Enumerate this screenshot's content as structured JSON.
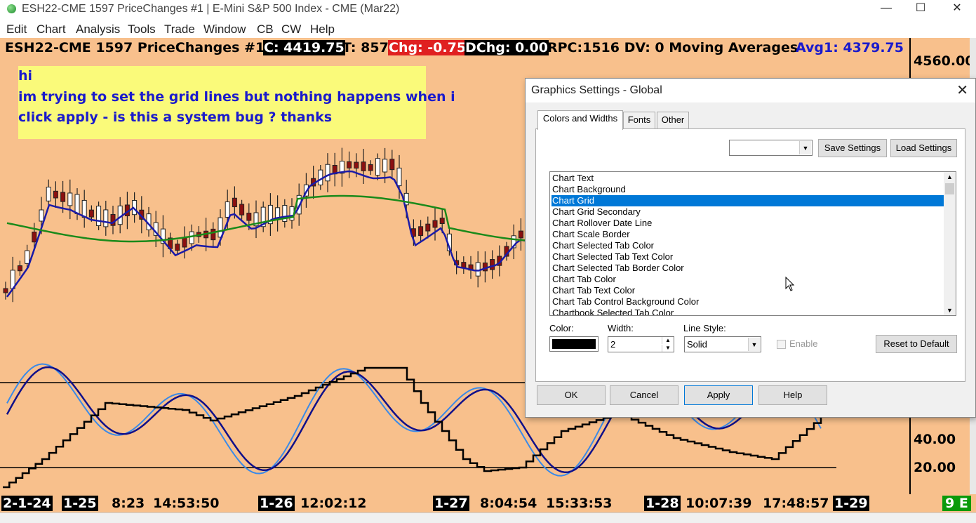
{
  "window": {
    "title": "ESH22-CME  1597 PriceChanges  #1 | E-Mini S&P 500 Index - CME (Mar22)",
    "minimize": "—",
    "maximize": "☐",
    "close": "✕"
  },
  "menu": [
    "Edit",
    "Chart",
    "Analysis",
    "Tools",
    "Trade",
    "Window",
    "CB",
    "CW",
    "Help"
  ],
  "info_bar": {
    "symbol": "ESH22-CME  1597 PriceChanges  #1",
    "close": "C: 4419.75",
    "ticks": "T: 857",
    "chg": "Chg: -0.75",
    "dchg": "DChg: 0.00",
    "study": "RPC:1516 DV: 0 Moving Averages",
    "avg1": "Avg1: 4379.75",
    "colors": {
      "close_bg": "#000000",
      "chg_bg": "#e02020",
      "avg1": "#1a1acc"
    }
  },
  "note": {
    "line1": "hi",
    "line2": "im trying to set the grid lines but nothing happens when i",
    "line3": "click apply - is this a system bug ? thanks"
  },
  "price_axis": {
    "top_label": "4560.00",
    "osc_labels": [
      "40.00",
      "20.00"
    ],
    "corner_badge": "9 E"
  },
  "time_axis": {
    "labels": [
      {
        "text": "2-1-24",
        "boxed": true
      },
      {
        "text": "1-25",
        "boxed": true
      },
      {
        "text": "8:23",
        "boxed": false
      },
      {
        "text": "14:53:50",
        "boxed": false
      },
      {
        "text": "1-26",
        "boxed": true
      },
      {
        "text": "12:02:12",
        "boxed": false
      },
      {
        "text": "1-27",
        "boxed": true
      },
      {
        "text": "8:04:54",
        "boxed": false
      },
      {
        "text": "15:33:53",
        "boxed": false
      },
      {
        "text": "1-28",
        "boxed": true
      },
      {
        "text": "10:07:39",
        "boxed": false
      },
      {
        "text": "17:48:57",
        "boxed": false
      },
      {
        "text": "1-29",
        "boxed": true
      }
    ]
  },
  "dialog": {
    "title": "Graphics Settings - Global",
    "tabs": [
      "Colors and Widths",
      "Fonts",
      "Other"
    ],
    "active_tab": "Colors and Widths",
    "save_settings": "Save Settings",
    "load_settings": "Load Settings",
    "settings_combo_value": "",
    "list_items": [
      "Chart Text",
      "Chart Background",
      "Chart Grid",
      "Chart Grid Secondary",
      "Chart Rollover Date Line",
      "Chart Scale Border",
      "Chart Selected Tab Color",
      "Chart Selected Tab Text Color",
      "Chart Selected Tab Border Color",
      "Chart Tab Color",
      "Chart Tab Text Color",
      "Chart Tab Control Background Color",
      "Chartbook Selected Tab Color"
    ],
    "selected_item": "Chart Grid",
    "color_label": "Color:",
    "color_value": "#000000",
    "width_label": "Width:",
    "width_value": "2",
    "line_style_label": "Line Style:",
    "line_style_value": "Solid",
    "enable_label": "Enable",
    "reset_default": "Reset to Default",
    "ok": "OK",
    "cancel": "Cancel",
    "apply": "Apply",
    "help": "Help"
  }
}
